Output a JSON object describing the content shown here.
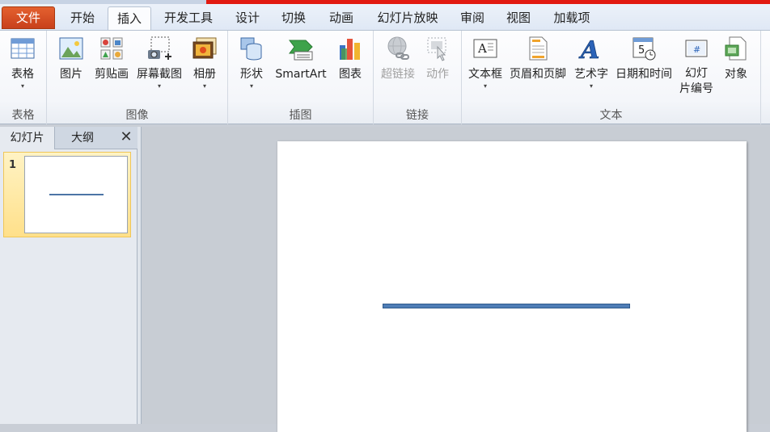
{
  "menu": {
    "file_label": "文件",
    "tabs": [
      "开始",
      "插入",
      "开发工具",
      "设计",
      "切换",
      "动画",
      "幻灯片放映",
      "审阅",
      "视图",
      "加载项"
    ],
    "active_tab": "插入"
  },
  "ribbon": {
    "groups": {
      "tables": {
        "label": "表格",
        "buttons": {
          "table": "表格"
        }
      },
      "images": {
        "label": "图像",
        "buttons": {
          "picture": "图片",
          "clip_art": "剪贴画",
          "screenshot": "屏幕截图",
          "photo_album": "相册"
        }
      },
      "illustrations": {
        "label": "插图",
        "buttons": {
          "shapes": "形状",
          "smartart": "SmartArt",
          "chart": "图表"
        }
      },
      "links": {
        "label": "链接",
        "buttons": {
          "hyperlink": "超链接",
          "action": "动作"
        }
      },
      "text": {
        "label": "文本",
        "buttons": {
          "text_box": "文本框",
          "header_footer": "页眉和页脚",
          "wordart": "艺术字",
          "date_time": "日期和时间",
          "slide_number_l1": "幻灯",
          "slide_number_l2": "片编号",
          "object": "对象"
        }
      }
    },
    "dropdown_arrow": "▾"
  },
  "pane": {
    "tabs": [
      "幻灯片",
      "大纲"
    ],
    "close_glyph": "✕",
    "slides": [
      {
        "number": "1"
      }
    ]
  },
  "icons": {
    "date_digit": "5",
    "slide_number_glyph": "#",
    "textbox_glyph": "A",
    "wordart_glyph": "A"
  },
  "colors": {
    "file_tab": "#d54f25",
    "accent_red": "#e21a10",
    "line_shape": "#4f7db6",
    "selected_thumb": "#ffe08a"
  }
}
